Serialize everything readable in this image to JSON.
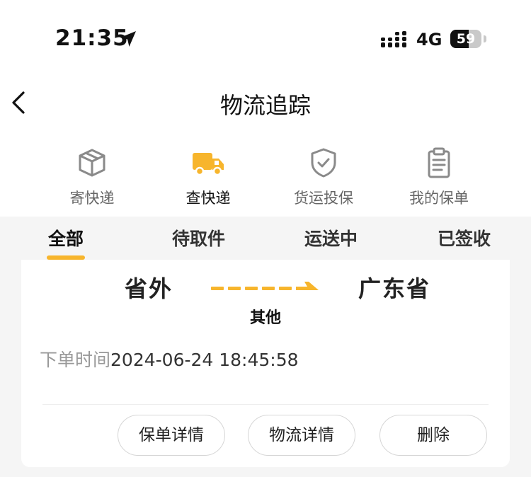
{
  "status_bar": {
    "time": "21:35",
    "network": "4G",
    "battery_percent": 59,
    "battery_text": "59"
  },
  "header": {
    "title": "物流追踪"
  },
  "services": [
    {
      "label": "寄快递",
      "icon": "package-icon",
      "active": false
    },
    {
      "label": "查快递",
      "icon": "truck-icon",
      "active": true
    },
    {
      "label": "货运投保",
      "icon": "shield-check-icon",
      "active": false
    },
    {
      "label": "我的保单",
      "icon": "clipboard-icon",
      "active": false
    }
  ],
  "tabs": [
    {
      "label": "全部",
      "active": true
    },
    {
      "label": "待取件",
      "active": false
    },
    {
      "label": "运送中",
      "active": false
    },
    {
      "label": "已签收",
      "active": false
    }
  ],
  "shipment": {
    "origin": "省外",
    "destination": "广东省",
    "carrier": "其他",
    "order_time_label": "下单时间",
    "order_time": "2024-06-24 18:45:58"
  },
  "actions": {
    "policy_detail": "保单详情",
    "logistics_detail": "物流详情",
    "delete": "删除"
  },
  "colors": {
    "accent": "#f7b52c",
    "background": "#f5f5f5",
    "card": "#ffffff"
  }
}
